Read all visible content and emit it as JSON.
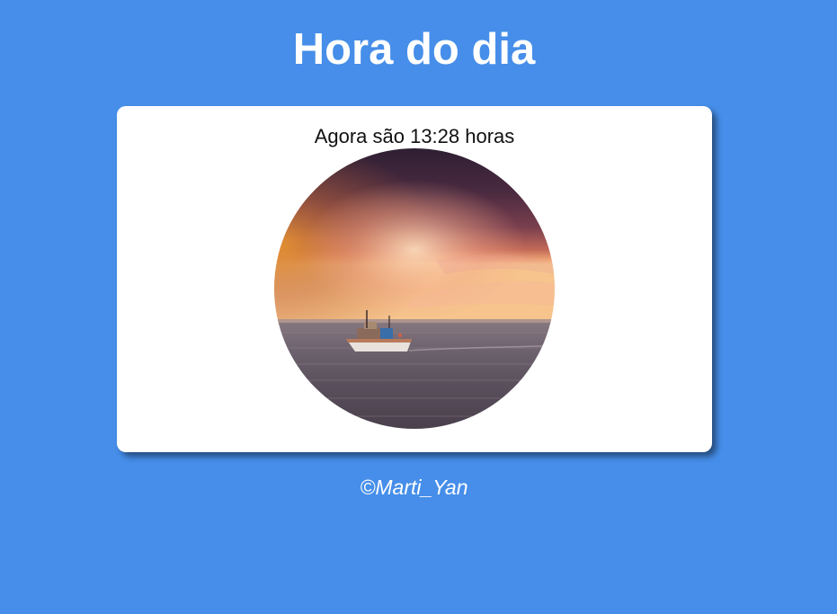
{
  "page": {
    "title": "Hora do dia",
    "background_color": "#468ee9"
  },
  "card": {
    "time_message": "Agora são 13:28 horas",
    "image": {
      "subject": "boat-at-sea-sunset",
      "shape": "circle"
    }
  },
  "footer": {
    "credit": "©Marti_Yan"
  }
}
